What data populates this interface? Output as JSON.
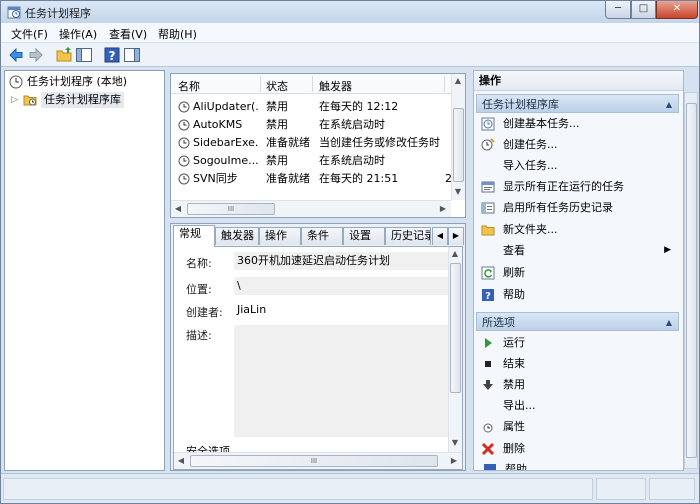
{
  "window": {
    "title": "任务计划程序",
    "minimize_label": "─",
    "maximize_label": "□",
    "close_label": "✕"
  },
  "menubar": {
    "items": [
      {
        "label": "文件(F)"
      },
      {
        "label": "操作(A)"
      },
      {
        "label": "查看(V)"
      },
      {
        "label": "帮助(H)"
      }
    ]
  },
  "toolbar": {
    "icons": [
      "back-arrow-icon",
      "forward-arrow-icon",
      "up-folder-icon",
      "show-hide-tree-icon",
      "help-icon",
      "show-hide-action-pane-icon"
    ]
  },
  "tree": {
    "root_label": "任务计划程序 (本地)",
    "child_label": "任务计划程序库",
    "expander": "▷"
  },
  "tasklist": {
    "columns": [
      "名称",
      "状态",
      "触发器"
    ],
    "rows": [
      {
        "name": "AliUpdater(...",
        "status": "禁用",
        "trigger": "在每天的 12:12",
        "extra": ""
      },
      {
        "name": "AutoKMS",
        "status": "禁用",
        "trigger": "在系统启动时",
        "extra": ""
      },
      {
        "name": "SidebarExe...",
        "status": "准备就绪",
        "trigger": "当创建任务或修改任务时",
        "extra": ""
      },
      {
        "name": "SogouIme...",
        "status": "禁用",
        "trigger": "在系统启动时",
        "extra": ""
      },
      {
        "name": "SVN同步",
        "status": "准备就绪",
        "trigger": "在每天的 21:51",
        "extra": "2"
      }
    ],
    "scroll_up": "▲",
    "scroll_down": "▼",
    "scroll_left": "◀",
    "scroll_right": "▶",
    "thumb_grip": "III"
  },
  "detail": {
    "tabs": [
      "常规",
      "触发器",
      "操作",
      "条件",
      "设置",
      "历史记录"
    ],
    "active_tab": "常规",
    "tab_scroll_left": "◀",
    "tab_scroll_right": "▶",
    "fields": {
      "name_label": "名称:",
      "name_value": "360开机加速延迟启动任务计划",
      "location_label": "位置:",
      "location_value": "\\",
      "author_label": "创建者:",
      "author_value": "JiaLin",
      "description_label": "描述:",
      "description_value": "",
      "security_label": "安全选项"
    },
    "thumb_grip": "III"
  },
  "actions": {
    "title": "操作",
    "section1": {
      "header": "任务计划程序库",
      "items": [
        {
          "icon": "create-basic-task-icon",
          "label": "创建基本任务..."
        },
        {
          "icon": "create-task-icon",
          "label": "创建任务..."
        },
        {
          "icon": "import-task-icon",
          "label": "导入任务..."
        },
        {
          "icon": "running-tasks-icon",
          "label": "显示所有正在运行的任务"
        },
        {
          "icon": "history-icon",
          "label": "启用所有任务历史记录"
        },
        {
          "icon": "new-folder-icon",
          "label": "新文件夹..."
        },
        {
          "icon": "",
          "label": "查看",
          "submenu": "▶"
        },
        {
          "icon": "refresh-icon",
          "label": "刷新"
        },
        {
          "icon": "help-icon",
          "label": "帮助"
        }
      ]
    },
    "section2": {
      "header": "所选项",
      "items": [
        {
          "icon": "run-icon",
          "label": "运行"
        },
        {
          "icon": "end-icon",
          "label": "结束"
        },
        {
          "icon": "disable-icon",
          "label": "禁用"
        },
        {
          "icon": "",
          "label": "导出..."
        },
        {
          "icon": "properties-icon",
          "label": "属性"
        },
        {
          "icon": "delete-icon",
          "label": "删除"
        },
        {
          "icon": "help-icon",
          "label": "帮助"
        }
      ]
    },
    "collapse_caret": "▲"
  },
  "colors": {
    "accent": "#2a5aa0",
    "section_header": "#bcd1e8",
    "window_frame": "#d6e2ef"
  }
}
